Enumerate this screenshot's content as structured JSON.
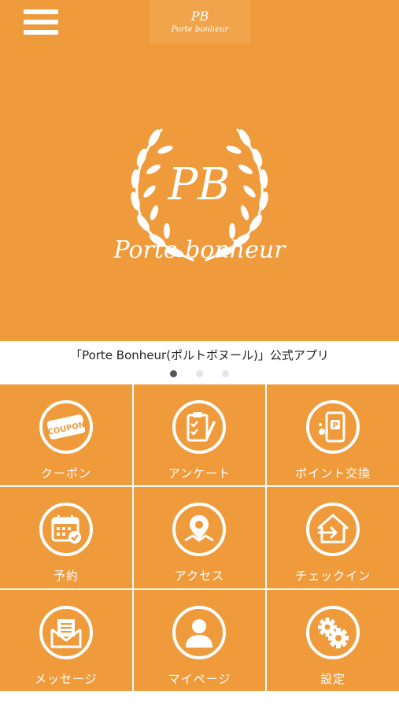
{
  "header": {
    "logo_monogram": "PB",
    "logo_name": "Porte bonheur"
  },
  "hero": {
    "monogram": "PB",
    "brand_name": "Porte bonheur"
  },
  "caption": "「Porte Bonheur(ポルトボヌール)」公式アプリ",
  "slider": {
    "count": 3,
    "active": 1
  },
  "menu": [
    {
      "label": "クーポン",
      "icon": "coupon-icon"
    },
    {
      "label": "アンケート",
      "icon": "survey-clipboard-icon"
    },
    {
      "label": "ポイント交換",
      "icon": "point-phone-icon"
    },
    {
      "label": "予約",
      "icon": "calendar-icon"
    },
    {
      "label": "アクセス",
      "icon": "map-pin-icon"
    },
    {
      "label": "チェックイン",
      "icon": "checkin-icon"
    },
    {
      "label": "メッセージ",
      "icon": "envelope-icon"
    },
    {
      "label": "マイページ",
      "icon": "user-icon"
    },
    {
      "label": "設定",
      "icon": "gear-icon"
    }
  ],
  "colors": {
    "accent": "#ef9b3c",
    "text": "#222222",
    "dot_active": "#555555",
    "dot_inactive": "#e6e6e6"
  }
}
